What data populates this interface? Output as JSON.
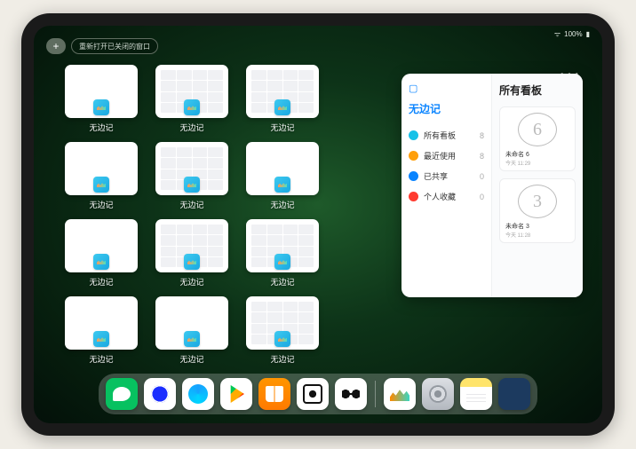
{
  "status": {
    "wifi": "⋮",
    "battery": "100%"
  },
  "top": {
    "plus": "+",
    "reopen_label": "重新打开已关闭的窗口"
  },
  "switcher": {
    "app_label": "无边记",
    "windows": [
      {
        "style": "blank"
      },
      {
        "style": "grid"
      },
      {
        "style": "grid"
      },
      {
        "style": "blank"
      },
      {
        "style": "grid"
      },
      {
        "style": "blank"
      },
      {
        "style": "blank"
      },
      {
        "style": "grid"
      },
      {
        "style": "grid"
      },
      {
        "style": "blank"
      },
      {
        "style": "blank"
      },
      {
        "style": "grid"
      }
    ],
    "grid_positions": [
      0,
      1,
      2,
      3,
      4,
      5,
      6,
      7,
      8,
      10,
      11,
      12
    ],
    "blank_positions": [
      9,
      13,
      14,
      15
    ]
  },
  "panel": {
    "ellipsis": "• • •",
    "left_title": "无边记",
    "right_title": "所有看板",
    "items": [
      {
        "label": "所有看板",
        "count": 8,
        "color": "#17c1e8"
      },
      {
        "label": "最近使用",
        "count": 8,
        "color": "#ff9f0a"
      },
      {
        "label": "已共享",
        "count": 0,
        "color": "#0a84ff"
      },
      {
        "label": "个人收藏",
        "count": 0,
        "color": "#ff3b30"
      }
    ],
    "boards": [
      {
        "glyph": "6",
        "name": "未命名 6",
        "sub": "今天 11:29"
      },
      {
        "glyph": "3",
        "name": "未命名 3",
        "sub": "今天 11:28"
      }
    ]
  },
  "dock": {
    "icons": [
      {
        "name": "wechat"
      },
      {
        "name": "quark"
      },
      {
        "name": "qqbrowser"
      },
      {
        "name": "play"
      },
      {
        "name": "books"
      },
      {
        "name": "dot"
      },
      {
        "name": "joy"
      }
    ],
    "recent": [
      {
        "name": "freeform"
      },
      {
        "name": "settings"
      },
      {
        "name": "notes"
      },
      {
        "name": "library"
      }
    ]
  }
}
